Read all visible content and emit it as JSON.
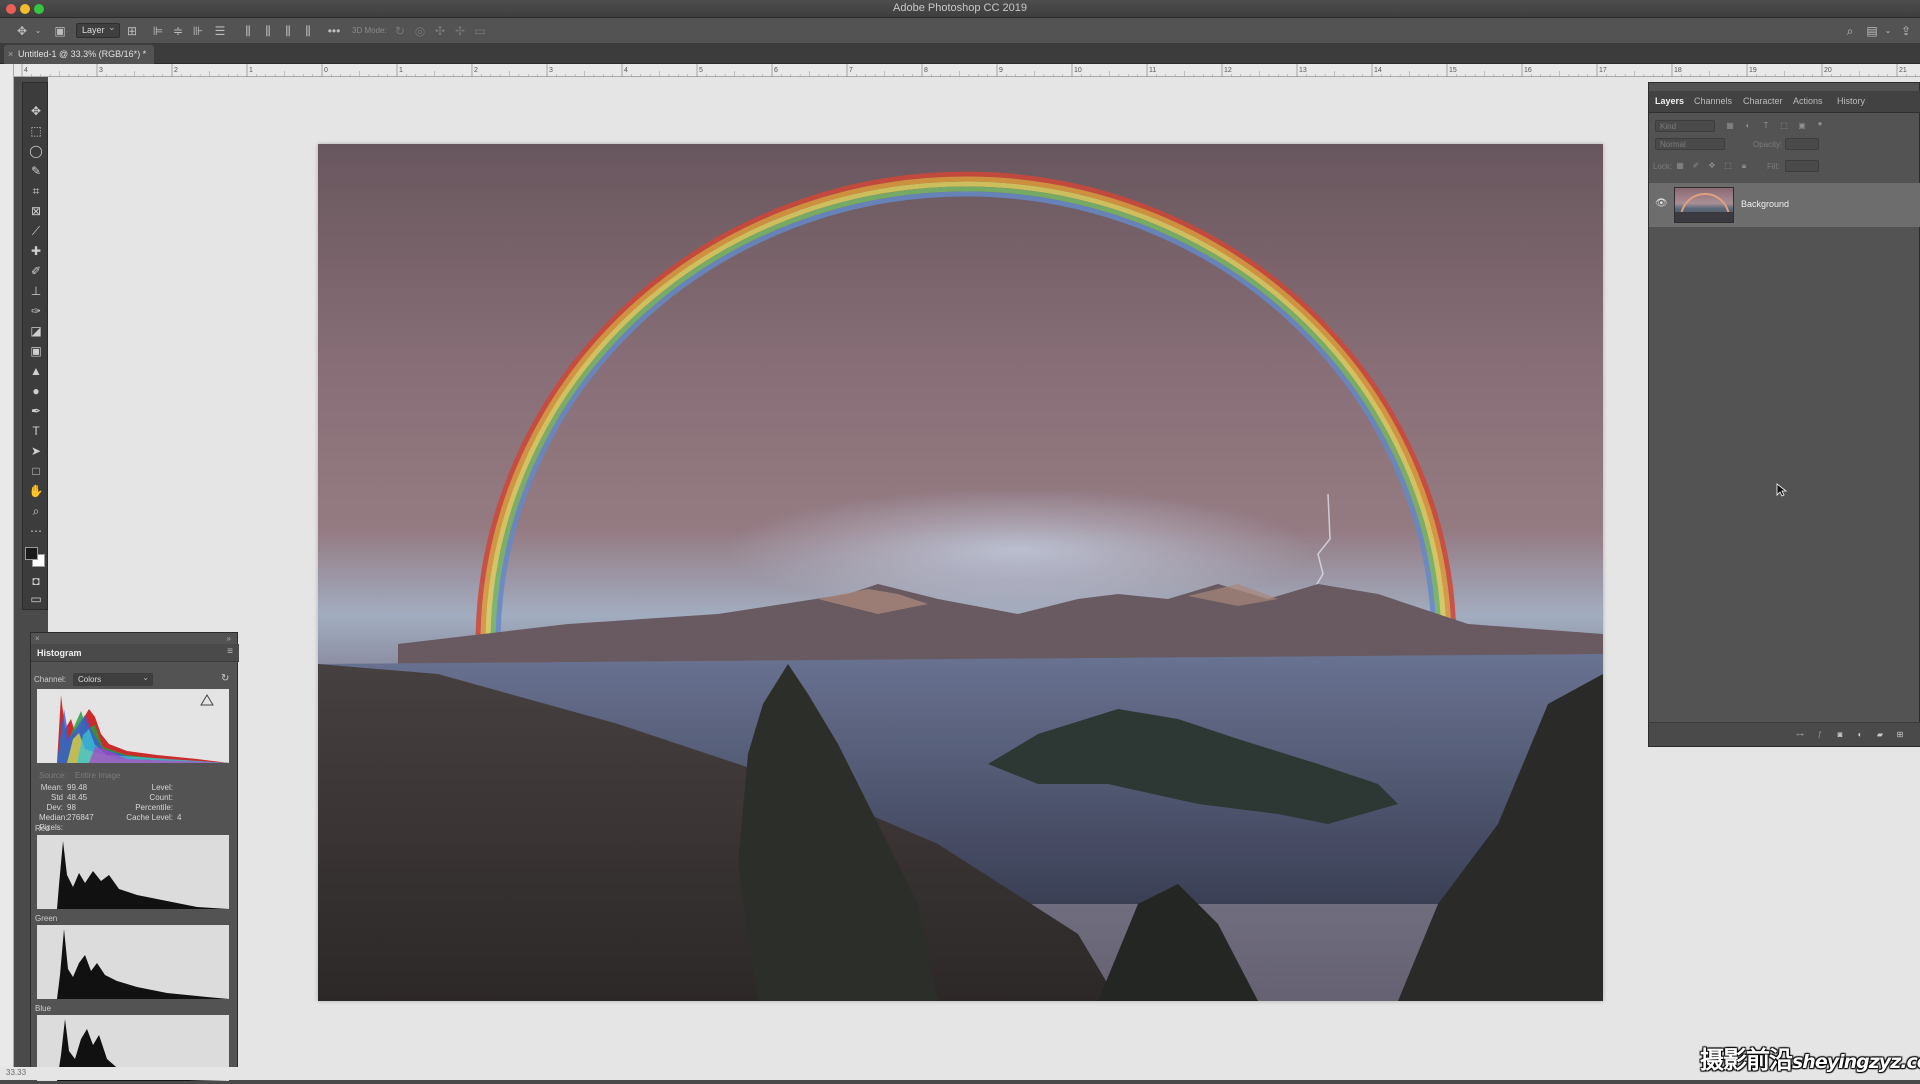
{
  "window": {
    "title": "Adobe Photoshop CC 2019"
  },
  "options_bar": {
    "auto_select_target": "Layer",
    "mode_3d_label": "3D Mode:"
  },
  "document": {
    "tab_title": "Untitled-1 @ 33.3% (RGB/16*) *",
    "zoom": "33.33"
  },
  "ruler": {
    "ticks": [
      "4",
      "3",
      "2",
      "1",
      "0",
      "1",
      "2",
      "3",
      "4",
      "5",
      "6",
      "7",
      "8",
      "9",
      "10",
      "11",
      "12",
      "13",
      "14",
      "15",
      "16",
      "17",
      "18",
      "19",
      "20",
      "21"
    ]
  },
  "toolbar": {
    "tools": [
      "move-tool",
      "marquee-tool",
      "lasso-tool",
      "quick-select-tool",
      "crop-tool",
      "frame-tool",
      "eyedropper-tool",
      "healing-brush-tool",
      "brush-tool",
      "clone-stamp-tool",
      "history-brush-tool",
      "eraser-tool",
      "gradient-tool",
      "blur-tool",
      "dodge-tool",
      "pen-tool",
      "type-tool",
      "path-select-tool",
      "rectangle-tool",
      "hand-tool",
      "zoom-tool",
      "more-tools"
    ],
    "foreground_color": "#1a1a1a",
    "background_color": "#ffffff"
  },
  "layers_panel": {
    "tabs": [
      "Layers",
      "Channels",
      "Character",
      "Actions",
      "History"
    ],
    "active_tab": "Layers",
    "filter_placeholder": "Kind",
    "blend_mode": "Normal",
    "opacity_label": "Opacity:",
    "lock_label": "Lock:",
    "fill_label": "Fill:",
    "layers": [
      {
        "name": "Background",
        "visible": true
      }
    ]
  },
  "histogram_panel": {
    "title": "Histogram",
    "channel_label": "Channel:",
    "channel_value": "Colors",
    "source_label": "Source:",
    "source_value": "Entire Image",
    "stats": {
      "mean_label": "Mean:",
      "mean": "99.48",
      "stddev_label": "Std Dev:",
      "stddev": "48.45",
      "median_label": "Median:",
      "median": "98",
      "pixels_label": "Pixels:",
      "pixels": "276847",
      "level_label": "Level:",
      "count_label": "Count:",
      "percentile_label": "Percentile:",
      "cache_label": "Cache Level:",
      "cache": "4"
    },
    "channels": [
      "Red",
      "Green",
      "Blue"
    ]
  },
  "watermark": {
    "text_cn": "摄影前沿",
    "text_url": "sheyingzyz.com"
  }
}
